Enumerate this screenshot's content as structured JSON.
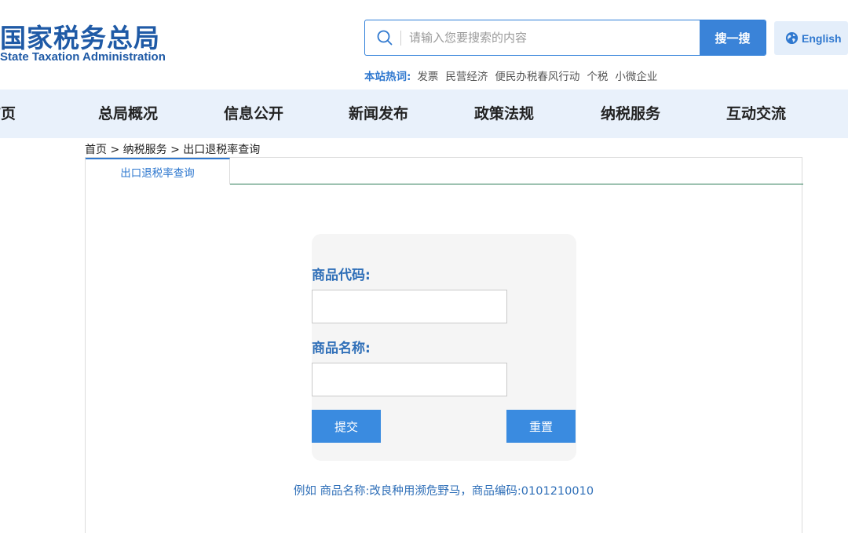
{
  "header": {
    "logo_cn": "国家税务总局",
    "logo_en": "State Taxation Administration",
    "search": {
      "placeholder": "请输入您要搜索的内容",
      "button_label": "搜一搜"
    },
    "english_label": "English",
    "hotwords": {
      "label": "本站热词:",
      "items": [
        "发票",
        "民营经济",
        "便民办税春风行动",
        "个税",
        "小微企业"
      ]
    }
  },
  "nav": {
    "items": [
      "首页",
      "总局概况",
      "信息公开",
      "新闻发布",
      "政策法规",
      "纳税服务",
      "互动交流"
    ]
  },
  "breadcrumb": "首页 >  纳税服务 > 出口退税率查询",
  "tab": {
    "label": "出口退税率查询"
  },
  "form": {
    "code_label": "商品代码:",
    "code_value": "",
    "name_label": "商品名称:",
    "name_value": "",
    "submit_label": "提交",
    "reset_label": "重置"
  },
  "example_text": "例如 商品名称:改良种用濒危野马，商品编码:0101210010",
  "colors": {
    "brand_blue": "#1f5aa6",
    "accent_blue": "#3a83d8",
    "nav_bg": "#e9f1fb",
    "tab_underline": "#2a7a55"
  }
}
